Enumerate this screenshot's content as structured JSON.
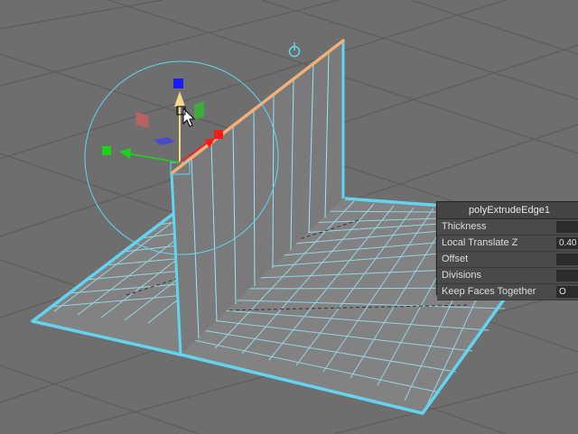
{
  "hud": {
    "title": "polyExtrudeEdge1",
    "attributes": [
      {
        "label": "Thickness",
        "value": ""
      },
      {
        "label": "Local Translate Z",
        "value": "0.40"
      },
      {
        "label": "Offset",
        "value": ""
      },
      {
        "label": "Divisions",
        "value": ""
      },
      {
        "label": "Keep Faces Together",
        "value": "O"
      }
    ]
  },
  "colors": {
    "background": "#6e6e6e",
    "grid_line": "#5f5f5f",
    "selection_edge": "#62d4f0",
    "wire": "#9ae4f4",
    "highlight_edge": "#f0b078",
    "manip_x": "#ff1a1a",
    "manip_y": "#1a1aff",
    "manip_z": "#1ad41a",
    "manip_center": "#f5d890"
  },
  "icons": {
    "pivot": "power-icon",
    "cursor": "arrow-cursor-icon"
  }
}
